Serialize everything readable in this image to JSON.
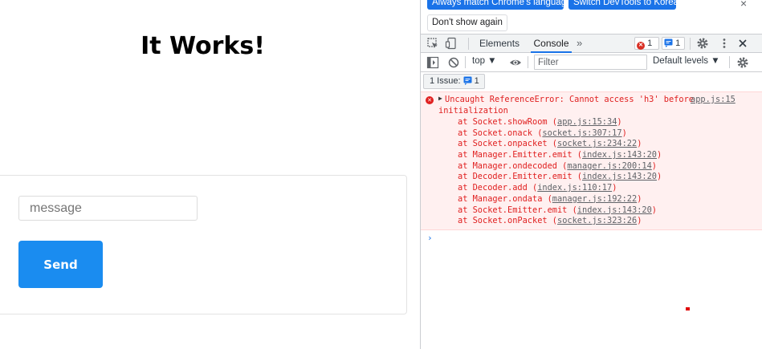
{
  "page": {
    "title": "It Works!",
    "message_placeholder": "message",
    "message_value": "",
    "send_label": "Send"
  },
  "devtools": {
    "language_bar": {
      "match_label": "Always match Chrome's language",
      "switch_label": "Switch DevTools to Korean",
      "dismiss_label": "Don't show again",
      "close_glyph": "×"
    },
    "tabs": [
      {
        "label": "Elements"
      },
      {
        "label": "Console"
      }
    ],
    "more_tabs_glyph": "»",
    "error_count": "1",
    "issue_count": "1",
    "toolbar": {
      "context": "top ▼",
      "filter_placeholder": "Filter",
      "levels": "Default levels ▼"
    },
    "issues_label": "1 Issue:",
    "issues_count": "1",
    "error": {
      "caret": "▶",
      "line1": "Uncaught ReferenceError: Cannot access 'h3' before",
      "line2": "initialization",
      "source": "app.js:15",
      "stack": [
        {
          "prefix": "at Socket.showRoom (",
          "loc": "app.js:15:34"
        },
        {
          "prefix": "at Socket.onack (",
          "loc": "socket.js:307:17"
        },
        {
          "prefix": "at Socket.onpacket (",
          "loc": "socket.js:234:22"
        },
        {
          "prefix": "at Manager.Emitter.emit (",
          "loc": "index.js:143:20"
        },
        {
          "prefix": "at Manager.ondecoded (",
          "loc": "manager.js:200:14"
        },
        {
          "prefix": "at Decoder.Emitter.emit (",
          "loc": "index.js:143:20"
        },
        {
          "prefix": "at Decoder.add (",
          "loc": "index.js:110:17"
        },
        {
          "prefix": "at Manager.ondata (",
          "loc": "manager.js:192:22"
        },
        {
          "prefix": "at Socket.Emitter.emit (",
          "loc": "index.js:143:20"
        },
        {
          "prefix": "at Socket.onPacket (",
          "loc": "socket.js:323:26"
        }
      ]
    },
    "prompt_glyph": "›",
    "colors": {
      "accent": "#1a73e8",
      "error": "#e02020",
      "error_bg": "#fff0f0",
      "send_button": "#1a8cf0"
    }
  }
}
